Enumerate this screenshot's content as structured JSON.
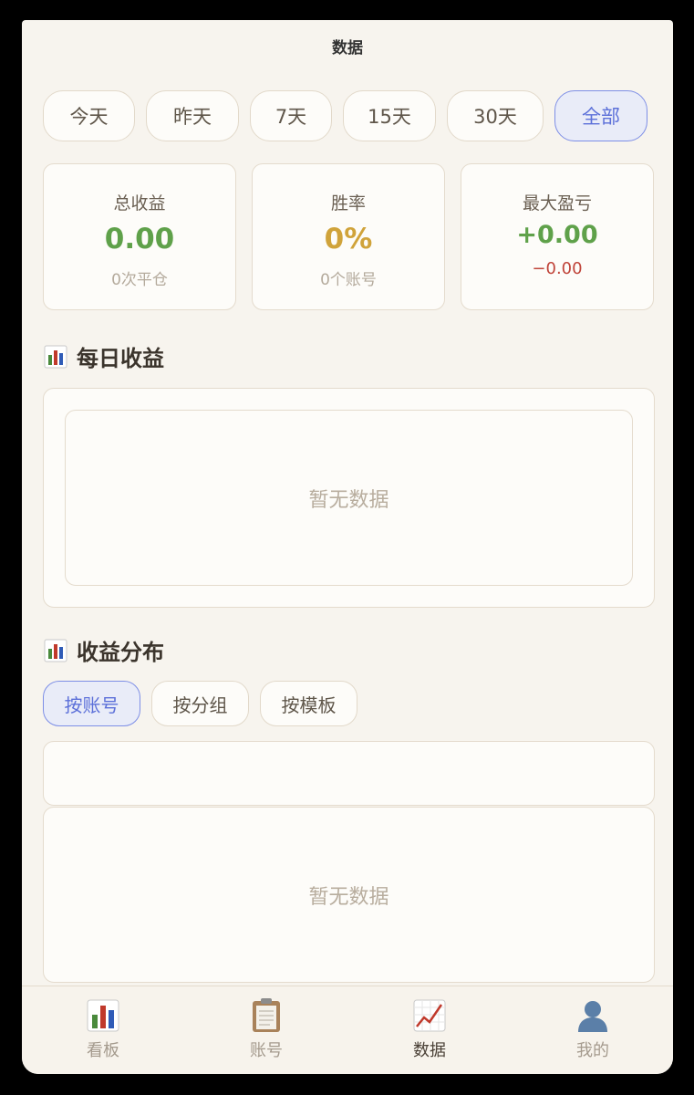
{
  "header": {
    "title": "数据"
  },
  "range_tabs": [
    {
      "label": "今天"
    },
    {
      "label": "昨天"
    },
    {
      "label": "7天"
    },
    {
      "label": "15天"
    },
    {
      "label": "30天"
    },
    {
      "label": "全部",
      "selected": true
    }
  ],
  "stats": {
    "total": {
      "label": "总收益",
      "value": "0.00",
      "sub": "0次平仓"
    },
    "winrate": {
      "label": "胜率",
      "value": "0%",
      "sub": "0个账号"
    },
    "maxpl": {
      "label": "最大盈亏",
      "value": "+0.00",
      "sub": "−0.00"
    }
  },
  "daily": {
    "title": "每日收益",
    "empty": "暂无数据",
    "icon": "bar-chart-icon"
  },
  "distribution": {
    "title": "收益分布",
    "icon": "bar-chart-icon",
    "segments": [
      {
        "label": "按账号",
        "selected": true
      },
      {
        "label": "按分组"
      },
      {
        "label": "按模板"
      }
    ],
    "empty": "暂无数据"
  },
  "tabbar": [
    {
      "label": "看板",
      "icon": "bar-chart-icon"
    },
    {
      "label": "账号",
      "icon": "clipboard-icon"
    },
    {
      "label": "数据",
      "icon": "trend-chart-icon",
      "active": true
    },
    {
      "label": "我的",
      "icon": "user-silhouette-icon"
    }
  ],
  "colors": {
    "accent": "#5c70d9",
    "positive": "#5fa14a",
    "gold": "#d0a33a",
    "negative": "#c0443a",
    "background": "#f7f4ee"
  }
}
